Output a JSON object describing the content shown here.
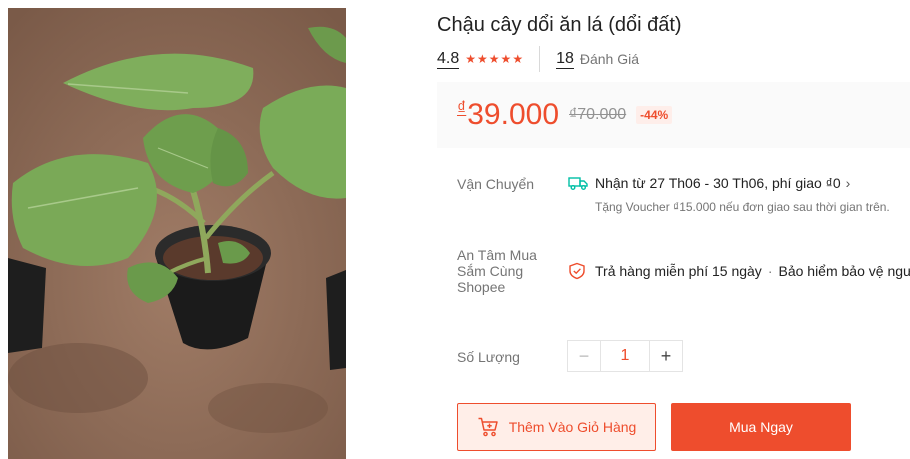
{
  "product": {
    "title": "Chậu cây dổi ăn lá (dổi đất)",
    "rating": "4.8",
    "stars": 5,
    "review_count": "18",
    "review_label": "Đánh Giá",
    "image_alt": "potted plant photo",
    "icons": {
      "star": "star-icon",
      "truck": "truck-icon",
      "shield": "shield-check-icon",
      "cart": "cart-add-icon",
      "chevron": "chevron-right-icon"
    }
  },
  "price": {
    "currency_symbol": "₫",
    "current": "39.000",
    "original": "₫70.000",
    "discount": "-44%"
  },
  "shipping": {
    "label": "Vận Chuyển",
    "text": "Nhận từ 27 Th06 - 30 Th06, phí giao ₫0",
    "voucher": "Tặng Voucher ₫15.000 nếu đơn giao sau thời gian trên."
  },
  "assurance": {
    "label": "An Tâm Mua Sắm Cùng Shopee",
    "return_text": "Trả hàng miễn phí 15 ngày",
    "separator": "·",
    "insurance_text": "Bảo hiểm bảo vệ người tiêu dùng"
  },
  "quantity": {
    "label": "Số Lượng",
    "value": "1",
    "minus": "−",
    "plus": "+"
  },
  "actions": {
    "add_to_cart": "Thêm Vào Giỏ Hàng",
    "buy_now": "Mua Ngay"
  },
  "colors": {
    "accent": "#ee4d2d",
    "price_bg": "#fafafa",
    "cart_bg": "#ffeee8",
    "muted_text": "#757575"
  }
}
